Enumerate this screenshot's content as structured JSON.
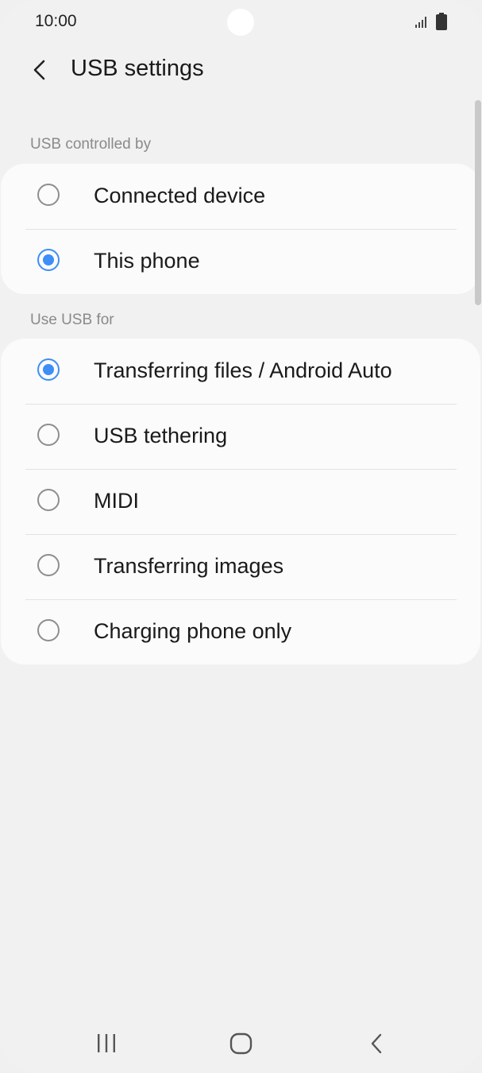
{
  "status_bar": {
    "time": "10:00",
    "icons": [
      "signal-icon",
      "battery-icon"
    ]
  },
  "header": {
    "back_icon": "chevron-left-icon",
    "title": "USB settings"
  },
  "sections": {
    "controlled_by": {
      "label": "USB controlled by",
      "options": [
        {
          "label": "Connected device",
          "selected": false
        },
        {
          "label": "This phone",
          "selected": true
        }
      ]
    },
    "use_usb_for": {
      "label": "Use USB for",
      "options": [
        {
          "label": "Transferring files / Android Auto",
          "selected": true
        },
        {
          "label": "USB tethering",
          "selected": false
        },
        {
          "label": "MIDI",
          "selected": false
        },
        {
          "label": "Transferring images",
          "selected": false
        },
        {
          "label": "Charging phone only",
          "selected": false
        }
      ]
    }
  },
  "nav_bar": {
    "icons": [
      "recents-icon",
      "home-icon",
      "back-icon"
    ]
  },
  "colors": {
    "accent": "#3e8ef7",
    "background": "#f1f1f1",
    "card": "#fbfbfb"
  }
}
